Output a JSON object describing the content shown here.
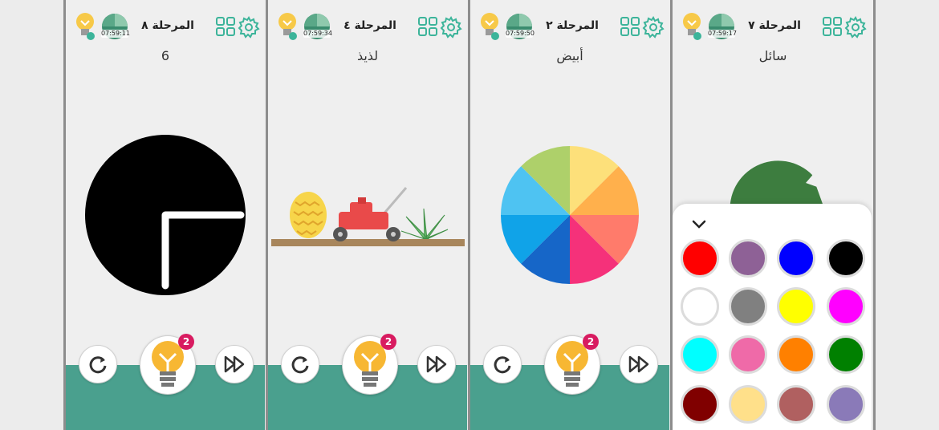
{
  "panels": [
    {
      "id": 1,
      "stage_label": "المرحلة ٨",
      "timer": "07:59:11",
      "word": "6",
      "badge": "2"
    },
    {
      "id": 2,
      "stage_label": "المرحلة ٤",
      "timer": "07:59:34",
      "word": "لذيذ",
      "badge": "2"
    },
    {
      "id": 3,
      "stage_label": "المرحلة ٢",
      "timer": "07:59:50",
      "word": "أبيض",
      "badge": "2"
    },
    {
      "id": 4,
      "stage_label": "المرحلة ٧",
      "timer": "07:59:17",
      "word": "سائل"
    }
  ],
  "icons": {
    "lightbulb": "lightbulb-icon",
    "timer": "timer-icon",
    "grid": "grid-icon",
    "gear": "gear-icon",
    "restart": "restart-icon",
    "skip": "fast-forward-icon",
    "chevron": "chevron-down-icon"
  },
  "colors": {
    "bottom_band": "#4aa08e",
    "accent_badge": "#d81b60",
    "icon_teal": "#3cb49a"
  },
  "color_options": [
    "#ff0000",
    "#8e6196",
    "#0000ff",
    "#000000",
    "#ffffff",
    "#808080",
    "#ffff00",
    "#ff00ff",
    "#00ffff",
    "#ef6aa8",
    "#ff8000",
    "#008000",
    "#800000",
    "#ffe08a",
    "#b06060",
    "#8a7ab8"
  ]
}
